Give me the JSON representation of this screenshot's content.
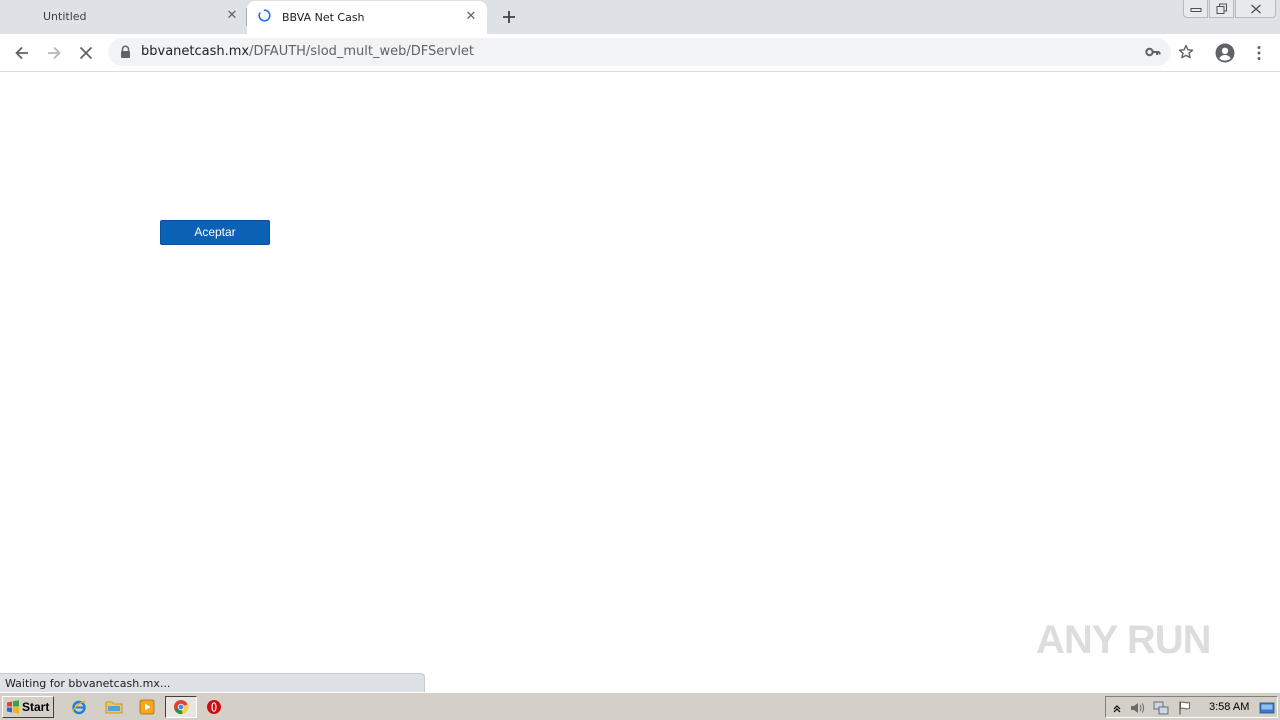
{
  "browser": {
    "tabs": [
      {
        "title": "Untitled",
        "active": false
      },
      {
        "title": "BBVA Net Cash",
        "active": true,
        "loading": true
      }
    ],
    "address": {
      "host": "bbvanetcash.mx",
      "path": "/DFAUTH/slod_mult_web/DFServlet"
    },
    "status_text": "Waiting for bbvanetcash.mx..."
  },
  "page": {
    "accept_button_label": "Aceptar",
    "watermark_text": "ANY RUN"
  },
  "taskbar": {
    "start_label": "Start",
    "clock": "3:58 AM"
  },
  "colors": {
    "accent_button": "#0b62b5",
    "tab_strip": "#dee1e6",
    "spinner": "#1a73e8"
  }
}
